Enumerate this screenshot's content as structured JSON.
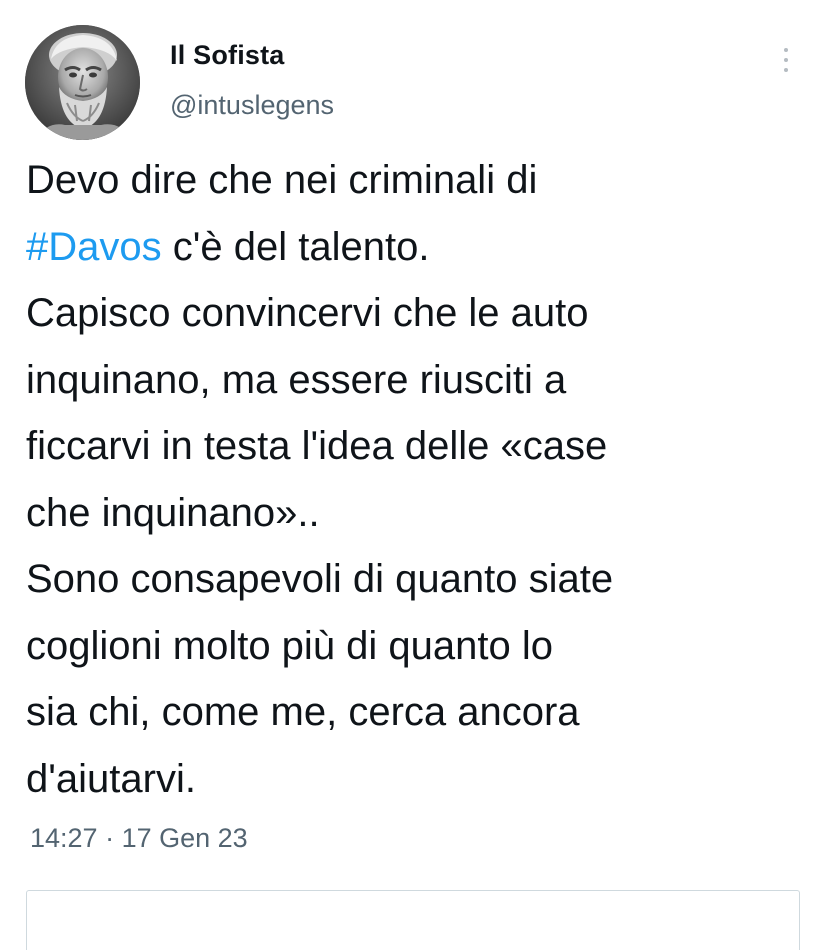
{
  "author": {
    "display_name": "Il Sofista",
    "handle": "@intuslegens",
    "avatar_icon": "bust-portrait-avatar"
  },
  "menu": {
    "icon": "more-vertical-icon"
  },
  "tweet": {
    "line1": "Devo dire che nei criminali di",
    "hashtag": "#Davos",
    "line2_rest": " c'è del talento.",
    "line3": "Capisco convincervi che le auto",
    "line4": "inquinano, ma essere riusciti a",
    "line5": "ficcarvi in testa l'idea delle «case",
    "line6": "che inquinano»..",
    "line7": "Sono consapevoli di quanto siate",
    "line8": "coglioni molto più di quanto lo",
    "line9": "sia chi, come me, cerca ancora",
    "line10": "d'aiutarvi."
  },
  "meta": {
    "time": "14:27",
    "separator": " · ",
    "date": "17 Gen 23"
  },
  "colors": {
    "hashtag": "#1d9bf0",
    "secondary_text": "#536471",
    "primary_text": "#0f1419"
  }
}
